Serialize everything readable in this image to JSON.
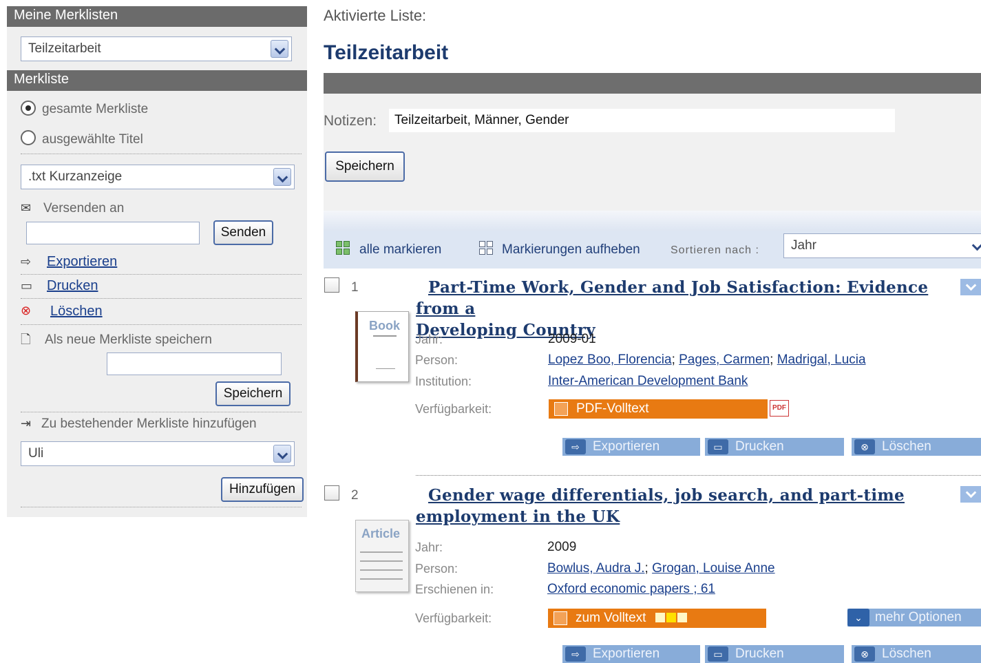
{
  "sidebar": {
    "header1": "Meine Merklisten",
    "list_select": "Teilzeitarbeit",
    "header2": "Merkliste",
    "radio_all": "gesamte Merkliste",
    "radio_selected": "ausgewählte Titel",
    "format_select": ".txt Kurzanzeige",
    "send_label": "Versenden an",
    "send_input": "",
    "send_button": "Senden",
    "export_link": "Exportieren",
    "print_link": "Drucken",
    "delete_link": "Löschen",
    "save_new_label": "Als neue Merkliste speichern",
    "save_new_input": "",
    "save_button": "Speichern",
    "add_existing_label": "Zu bestehender Merkliste hinzufügen",
    "existing_select": "Uli",
    "add_button": "Hinzufügen"
  },
  "main": {
    "active_label": "Aktivierte Liste:",
    "title": "Teilzeitarbeit",
    "notes_label": "Notizen:",
    "notes_value": "Teilzeitarbeit, Männer, Gender",
    "save_button": "Speichern",
    "toolbar": {
      "mark_all": "alle markieren",
      "unmark": "Markierungen aufheben",
      "sort_label": "Sortieren nach :",
      "sort_value": "Jahr"
    }
  },
  "results": [
    {
      "num": "1",
      "title_line1": "Part-Time Work, Gender and Job Satisfaction: Evidence from a",
      "title_line2": "Developing Country",
      "cover_label": "Book",
      "year_label": "Jahr:",
      "year": "2009-01",
      "person_label": "Person:",
      "persons": [
        "Lopez Boo, Florencia",
        "Pages, Carmen",
        "Madrigal, Lucia"
      ],
      "inst_label": "Institution:",
      "institution": "Inter-American Development Bank",
      "avail_label": "Verfügbarkeit:",
      "avail_button": "PDF-Volltext",
      "export": "Exportieren",
      "print": "Drucken",
      "delete": "Löschen"
    },
    {
      "num": "2",
      "title_line1": "Gender wage differentials, job search, and part-time",
      "title_line2": "employment in the UK",
      "cover_label": "Article",
      "year_label": "Jahr:",
      "year": "2009",
      "person_label": "Person:",
      "persons": [
        "Bowlus, Audra J.",
        "Grogan, Louise Anne"
      ],
      "pub_label": "Erschienen in:",
      "published_in": "Oxford economic papers ; 61",
      "avail_label": "Verfügbarkeit:",
      "avail_button": "zum Volltext",
      "more_options": "mehr Optionen",
      "export": "Exportieren",
      "print": "Drucken",
      "delete": "Löschen"
    }
  ],
  "colors": {
    "header_gray": "#6b6b6b",
    "title_blue": "#1d3b6e",
    "orange": "#e87a12",
    "action_blue": "#88acd9"
  }
}
